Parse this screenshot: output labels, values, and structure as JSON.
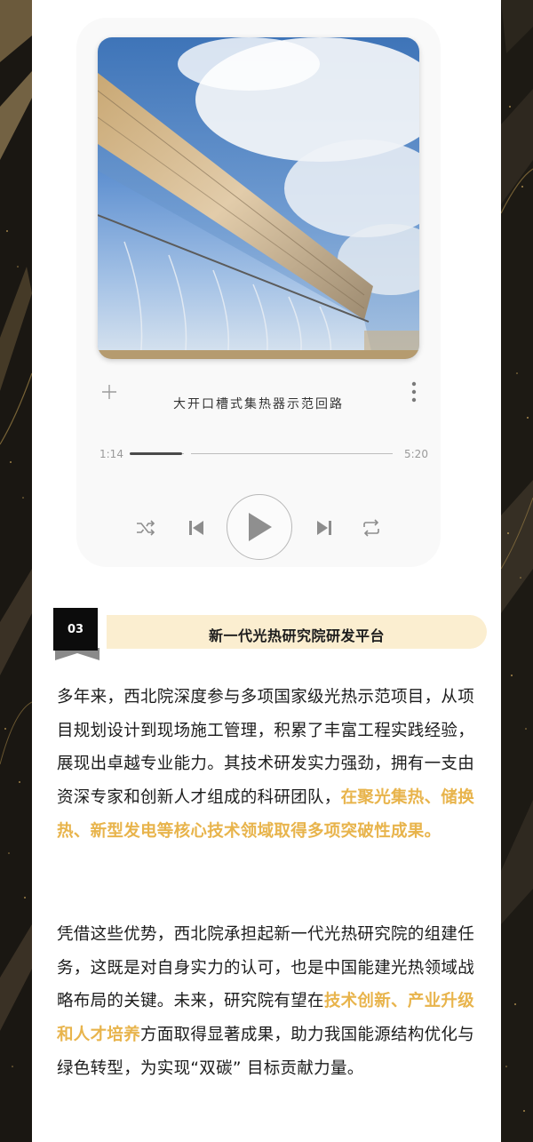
{
  "player": {
    "track_title": "大开口槽式集热器示范回路",
    "current_time": "1:14",
    "total_time": "5:20",
    "progress": 0.2,
    "controls": {
      "add": "plus-icon",
      "more": "more-vertical-icon",
      "shuffle": "shuffle-icon",
      "previous": "skip-previous-icon",
      "play": "play-icon",
      "next": "skip-next-icon",
      "repeat": "repeat-icon"
    }
  },
  "section": {
    "number": "03",
    "title": "新一代光热研究院研发平台"
  },
  "article": {
    "p1": {
      "text": "多年来，西北院深度参与多项国家级光热示范项目，从项目规划设计到现场施工管理，积累了丰富工程实践经验，展现出卓越专业能力。其技术研发实力强劲，拥有一支由资深专家和创新人才组成的科研团队，",
      "highlight": "在聚光集热、储换热、新型发电等核心技术领域取得多项突破性成果。"
    },
    "p2": {
      "text_before": "凭借这些优势，西北院承担起新一代光热研究院的组建任务，这既是对自身实力的认可，也是中国能建光热领域战略布局的关键。未来，研究院有望在",
      "highlight": "技术创新、产业升级和人才培养",
      "text_after": "方面取得显著成果，助力我国能源结构优化与绿色转型，为实现“双碳” 目标贡献力量。"
    }
  },
  "colors": {
    "highlight": "#e8b44c",
    "section_pill": "#fbeed0",
    "section_number_bg": "#0c0c0c",
    "border_dark": "#1a1712",
    "border_gold": "#b8964e"
  }
}
